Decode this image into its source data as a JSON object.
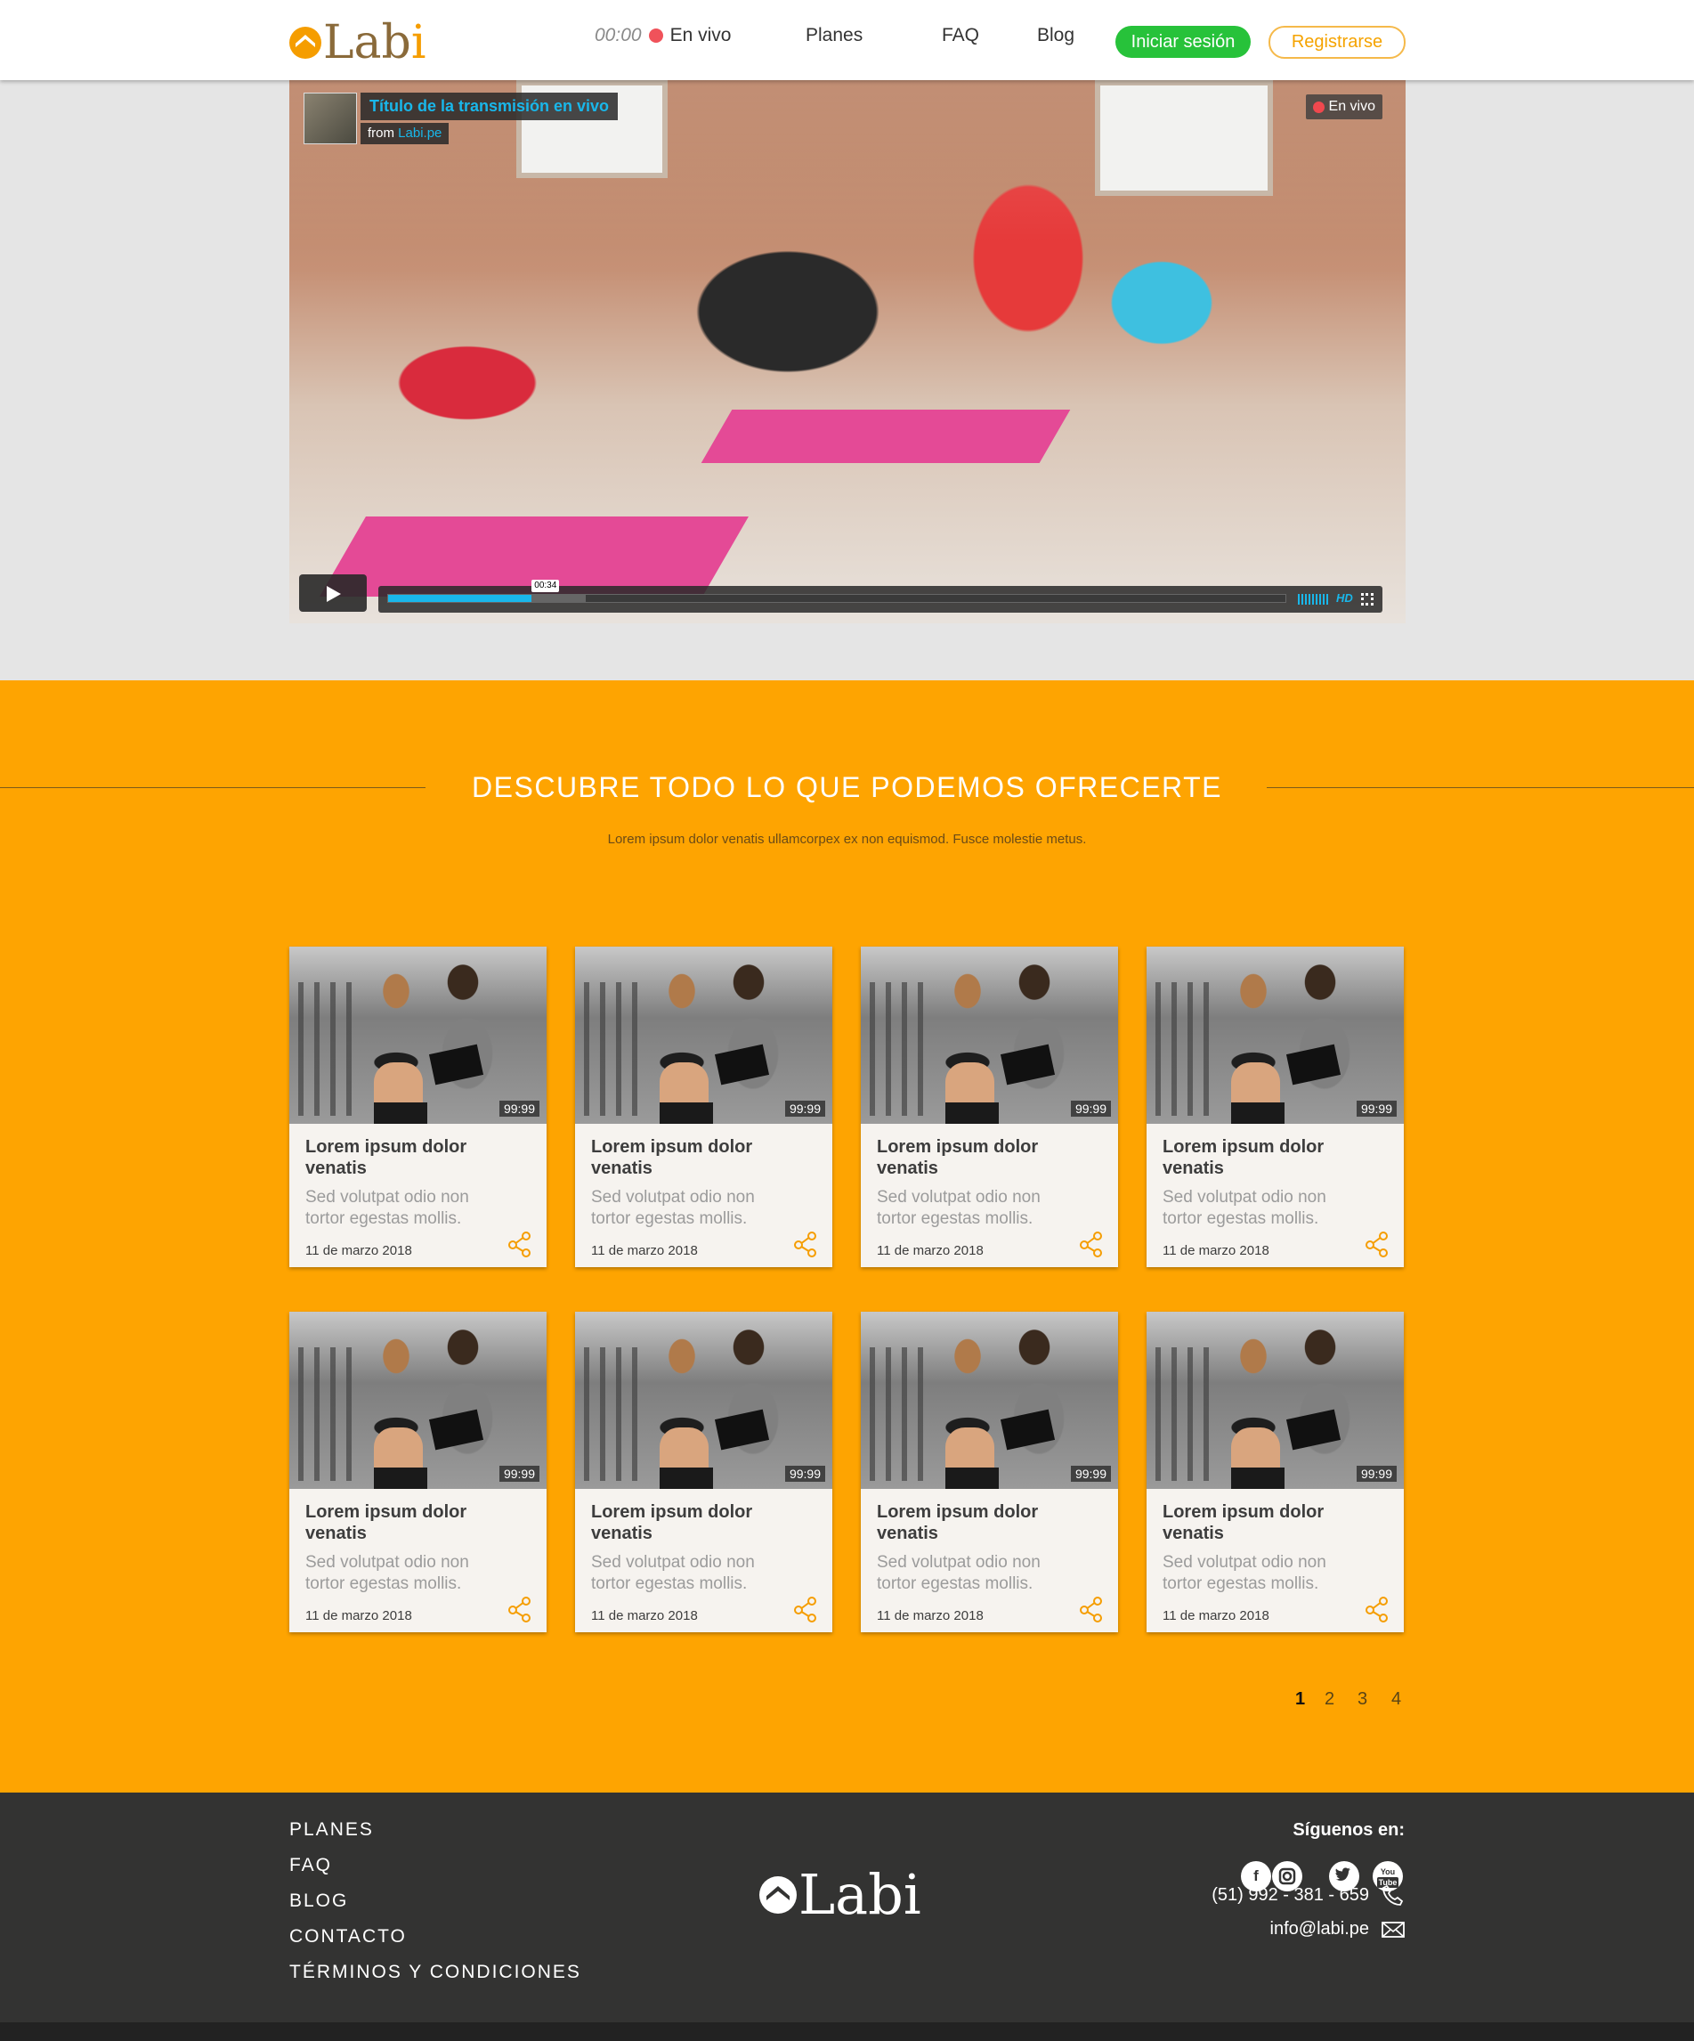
{
  "header": {
    "logo_text": "Labi",
    "live_time": "00:00",
    "live_label": "En vivo",
    "nav": [
      "Planes",
      "FAQ",
      "Blog"
    ],
    "login": "Iniciar sesión",
    "register": "Registrarse"
  },
  "video": {
    "title": "Título de la transmisión en vivo",
    "from_prefix": "from",
    "from_source": "Labi.pe",
    "live_badge": "En vivo",
    "current_time": "00:34",
    "progress": 0.16,
    "buffered": 0.22,
    "quality": "HD"
  },
  "section": {
    "title": "DESCUBRE TODO LO QUE PODEMOS OFRECERTE",
    "subtitle": "Lorem ipsum dolor venatis ullamcorpex ex non equismod. Fusce molestie metus."
  },
  "cards": [
    {
      "duration": "99:99",
      "title": "Lorem ipsum dolor venatis",
      "desc": "Sed volutpat odio non tortor egestas mollis.",
      "date": "11 de marzo 2018"
    },
    {
      "duration": "99:99",
      "title": "Lorem ipsum dolor venatis",
      "desc": "Sed volutpat odio non tortor egestas mollis.",
      "date": "11 de marzo 2018"
    },
    {
      "duration": "99:99",
      "title": "Lorem ipsum dolor venatis",
      "desc": "Sed volutpat odio non tortor egestas mollis.",
      "date": "11 de marzo 2018"
    },
    {
      "duration": "99:99",
      "title": "Lorem ipsum dolor venatis",
      "desc": "Sed volutpat odio non tortor egestas mollis.",
      "date": "11 de marzo 2018"
    },
    {
      "duration": "99:99",
      "title": "Lorem ipsum dolor venatis",
      "desc": "Sed volutpat odio non tortor egestas mollis.",
      "date": "11 de marzo 2018"
    },
    {
      "duration": "99:99",
      "title": "Lorem ipsum dolor venatis",
      "desc": "Sed volutpat odio non tortor egestas mollis.",
      "date": "11 de marzo 2018"
    },
    {
      "duration": "99:99",
      "title": "Lorem ipsum dolor venatis",
      "desc": "Sed volutpat odio non tortor egestas mollis.",
      "date": "11 de marzo 2018"
    },
    {
      "duration": "99:99",
      "title": "Lorem ipsum dolor venatis",
      "desc": "Sed volutpat odio non tortor egestas mollis.",
      "date": "11 de marzo 2018"
    }
  ],
  "pagination": {
    "pages": [
      "1",
      "2",
      "3",
      "4"
    ],
    "current": "1"
  },
  "footer": {
    "links": [
      "PLANES",
      "FAQ",
      "BLOG",
      "CONTACTO",
      "TÉRMINOS Y CONDICIONES"
    ],
    "logo_text": "Labi",
    "follow_label": "Síguenos en:",
    "social_icons": [
      "facebook-icon",
      "instagram-icon",
      "twitter-icon",
      "youtube-icon"
    ],
    "phone": "(51) 992 - 381 - 659",
    "email": "info@labi.pe"
  },
  "colors": {
    "accent_orange": "#fea401",
    "login_green": "#27c23a",
    "live_red": "#f0525a",
    "video_blue": "#19b7ea",
    "footer_bg": "#333332"
  }
}
